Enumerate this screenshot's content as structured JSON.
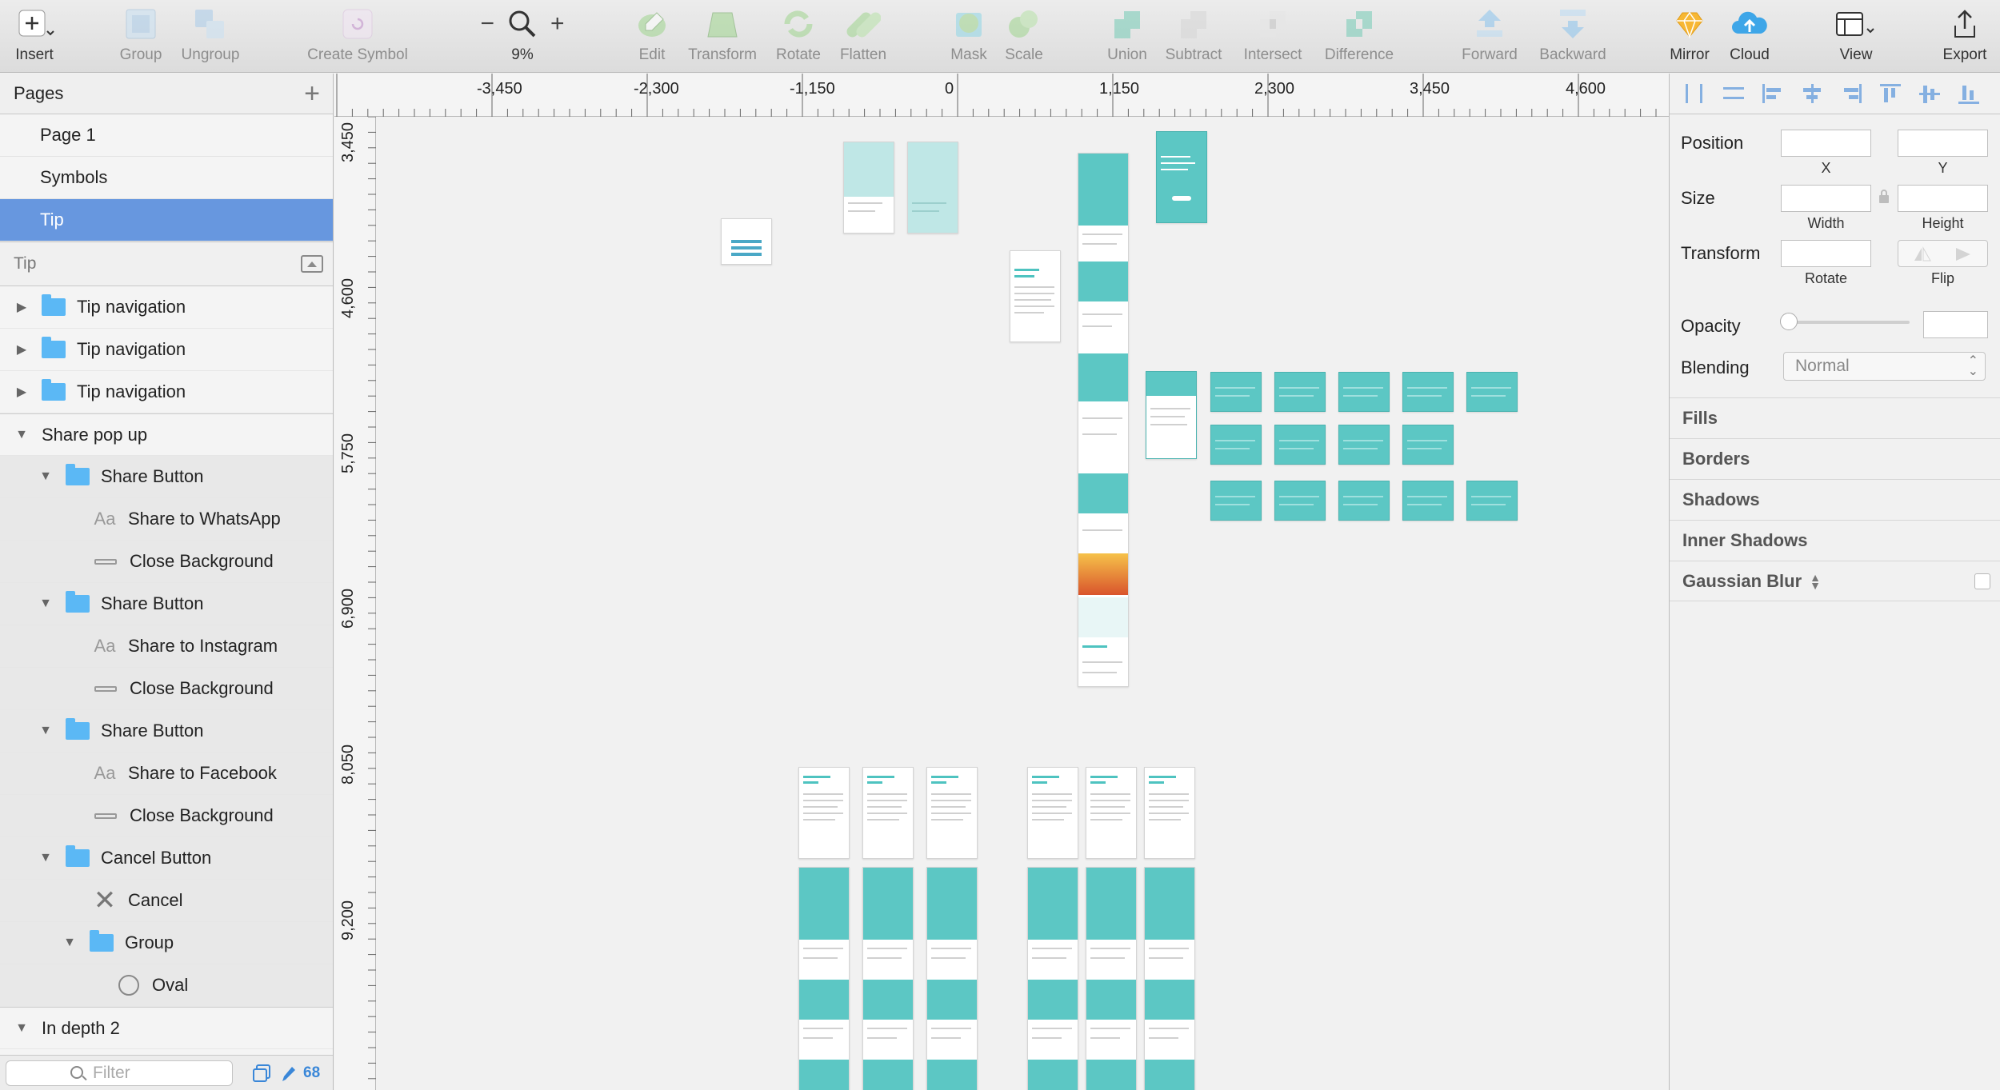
{
  "toolbar": {
    "insert": "Insert",
    "group": "Group",
    "ungroup": "Ungroup",
    "create_symbol": "Create Symbol",
    "zoom_level": "9%",
    "edit": "Edit",
    "transform": "Transform",
    "rotate": "Rotate",
    "flatten": "Flatten",
    "mask": "Mask",
    "scale": "Scale",
    "union": "Union",
    "subtract": "Subtract",
    "intersect": "Intersect",
    "difference": "Difference",
    "forward": "Forward",
    "backward": "Backward",
    "mirror": "Mirror",
    "cloud": "Cloud",
    "view": "View",
    "export": "Export"
  },
  "pages": {
    "title": "Pages",
    "items": [
      "Page 1",
      "Symbols",
      "Tip"
    ],
    "selected": "Tip"
  },
  "layers": {
    "title": "Tip",
    "rows": [
      {
        "label": "Tip navigation"
      },
      {
        "label": "Tip navigation"
      },
      {
        "label": "Tip navigation"
      },
      {
        "label": "Share pop up"
      },
      {
        "label": "Share Button"
      },
      {
        "label": "Share to WhatsApp"
      },
      {
        "label": "Close Background"
      },
      {
        "label": "Share Button"
      },
      {
        "label": "Share to Instagram"
      },
      {
        "label": "Close Background"
      },
      {
        "label": "Share Button"
      },
      {
        "label": "Share to Facebook"
      },
      {
        "label": "Close Background"
      },
      {
        "label": "Cancel Button"
      },
      {
        "label": "Cancel"
      },
      {
        "label": "Group"
      },
      {
        "label": "Oval"
      },
      {
        "label": "In depth 2"
      }
    ],
    "filter_placeholder": "Filter",
    "count": "68"
  },
  "ruler": {
    "top_labels": [
      "-3,450",
      "-2,300",
      "-1,150",
      "0",
      "1,150",
      "2,300",
      "3,450",
      "4,600"
    ],
    "left_labels": [
      "3,450",
      "4,600",
      "5,750",
      "6,900",
      "8,050",
      "9,200"
    ]
  },
  "inspector": {
    "position": "Position",
    "x": "X",
    "y": "Y",
    "size": "Size",
    "width": "Width",
    "height": "Height",
    "transform": "Transform",
    "rotate": "Rotate",
    "flip": "Flip",
    "opacity": "Opacity",
    "blending": "Blending",
    "blending_value": "Normal",
    "sections": [
      "Fills",
      "Borders",
      "Shadows",
      "Inner Shadows",
      "Gaussian Blur"
    ]
  },
  "colors": {
    "selection": "#6797df",
    "folder": "#5bb8f5",
    "artboard_teal": "#5cc7c4",
    "sketch_orange": "#f7b733"
  }
}
